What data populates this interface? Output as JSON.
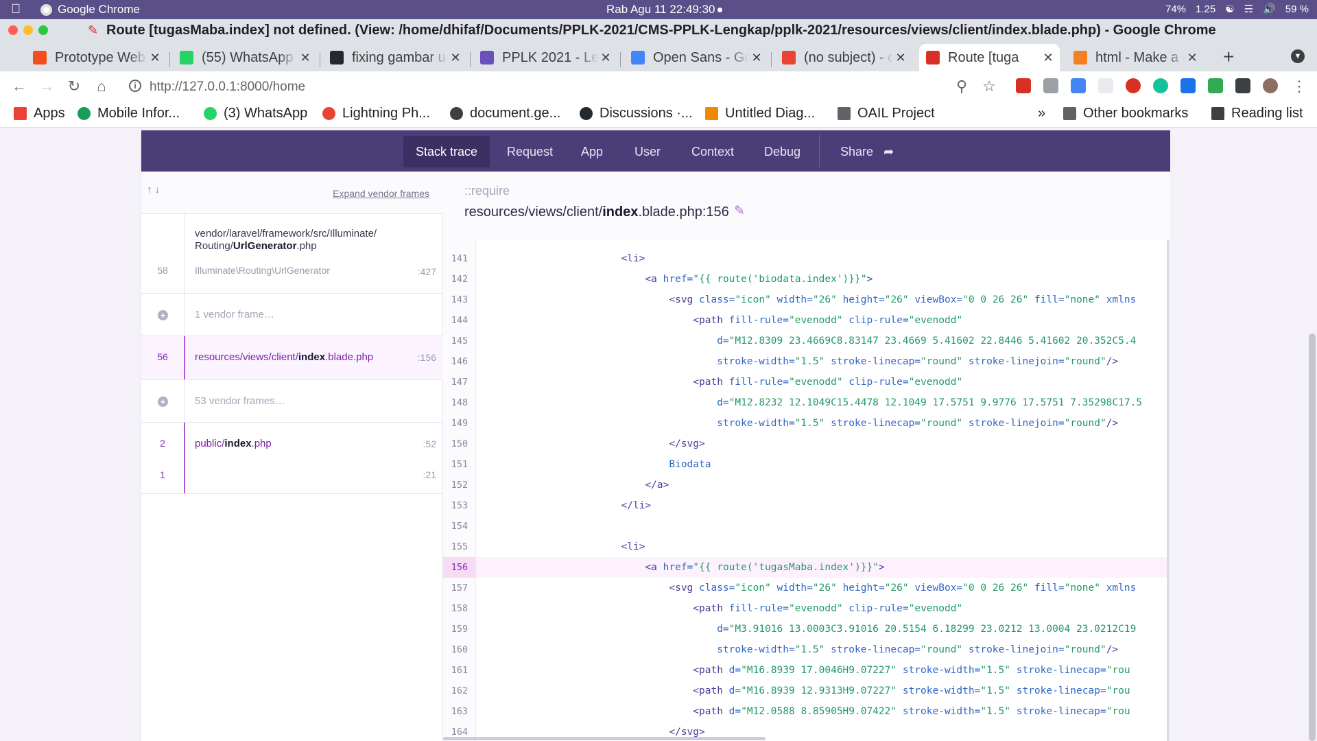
{
  "menubar": {
    "app_name": "Google Chrome",
    "clock": "Rab Agu 11  22:49:30",
    "status": [
      "74%",
      "1.25",
      "59 %"
    ]
  },
  "window": {
    "title": "Route [tugasMaba.index] not defined. (View: /home/dhifaf/Documents/PPLK-2021/CMS-PPLK-Lengkap/pplk-2021/resources/views/client/index.blade.php) - Google Chrome"
  },
  "tabs": [
    {
      "label": "Prototype Web",
      "icon": "figma-icon",
      "color": "#f24e1e"
    },
    {
      "label": "(55) WhatsApp",
      "icon": "whatsapp-icon",
      "color": "#25d366"
    },
    {
      "label": "fixing gambar u",
      "icon": "github-icon",
      "color": "#24292e"
    },
    {
      "label": "PPLK 2021 - Le",
      "icon": "pplk-icon",
      "color": "#6b4fbb"
    },
    {
      "label": "Open Sans - Go",
      "icon": "google-fonts-icon",
      "color": "#4285f4"
    },
    {
      "label": "(no subject) - d",
      "icon": "gmail-icon",
      "color": "#ea4335"
    },
    {
      "label": "Route [tuga",
      "icon": "laravel-icon",
      "color": "#d93025"
    },
    {
      "label": "html - Make a c",
      "icon": "stackoverflow-icon",
      "color": "#f48024"
    }
  ],
  "toolbar": {
    "url": "http://127.0.0.1:8000/home"
  },
  "bookmarks": [
    {
      "label": "Apps",
      "icon": "apps-grid-icon",
      "color": "#ea4335"
    },
    {
      "label": "Mobile Infor...",
      "icon": "mobile-info-icon",
      "color": "#1a9c5b"
    },
    {
      "label": "(3) WhatsApp",
      "icon": "whatsapp-icon",
      "color": "#25d366"
    },
    {
      "label": "Lightning Ph...",
      "icon": "google-icon",
      "color": "#ea4335"
    },
    {
      "label": "document.ge...",
      "icon": "globe-icon",
      "color": "#3c4043"
    },
    {
      "label": "Discussions ·...",
      "icon": "github-icon",
      "color": "#24292e"
    },
    {
      "label": "Untitled Diag...",
      "icon": "drawio-icon",
      "color": "#f08705"
    },
    {
      "label": "OAIL Project",
      "icon": "folder-icon",
      "color": "#5f6368"
    }
  ],
  "bookmarks_right": {
    "more": "»",
    "other": "Other bookmarks",
    "reading": "Reading list"
  },
  "ignition": {
    "tabs": [
      "Stack trace",
      "Request",
      "App",
      "User",
      "Context",
      "Debug"
    ],
    "share": "Share",
    "expand_vendor": "Expand vendor frames",
    "frames": [
      {
        "num": "58",
        "path_pre": "vendor/laravel/framework/src/Illuminate/",
        "path_mid": "Routing/",
        "path_bold": "UrlGenerator",
        "path_post": ".php",
        "class": "Illuminate\\Routing\\UrlGenerator",
        "line": ":427"
      },
      {
        "label": "1 vendor frame…"
      },
      {
        "num": "56",
        "path_pre": "resources/views/client/",
        "path_bold": "index",
        "path_post": ".blade.php",
        "line": ":156"
      },
      {
        "label": "53 vendor frames…"
      },
      {
        "num": "2",
        "path_pre": "public/",
        "path_bold": "index",
        "path_post": ".php",
        "line": ":52"
      },
      {
        "num": "1",
        "line": ":21"
      }
    ],
    "snippet": {
      "require": "::require",
      "file_pre": "resources/views/client/",
      "file_bold": "index",
      "file_post": ".blade.php:156"
    }
  },
  "code_lines": [
    {
      "n": "141",
      "indent": "                        ",
      "t": [
        [
          "tag",
          "<li>"
        ]
      ]
    },
    {
      "n": "142",
      "indent": "                            ",
      "t": [
        [
          "tag",
          "<a "
        ],
        [
          "attr",
          "href="
        ],
        [
          "str",
          "\"{{ route('biodata.index')}}\""
        ],
        [
          "tag",
          ">"
        ]
      ]
    },
    {
      "n": "143",
      "indent": "                                ",
      "t": [
        [
          "tag",
          "<svg "
        ],
        [
          "attr",
          "class="
        ],
        [
          "str",
          "\"icon\" "
        ],
        [
          "attr",
          "width="
        ],
        [
          "str",
          "\"26\" "
        ],
        [
          "attr",
          "height="
        ],
        [
          "str",
          "\"26\" "
        ],
        [
          "attr",
          "viewBox="
        ],
        [
          "str",
          "\"0 0 26 26\" "
        ],
        [
          "attr",
          "fill="
        ],
        [
          "str",
          "\"none\" "
        ],
        [
          "attr",
          "xmlns"
        ]
      ]
    },
    {
      "n": "144",
      "indent": "                                    ",
      "t": [
        [
          "tag",
          "<path "
        ],
        [
          "attr",
          "fill-rule="
        ],
        [
          "str",
          "\"evenodd\" "
        ],
        [
          "attr",
          "clip-rule="
        ],
        [
          "str",
          "\"evenodd\""
        ]
      ]
    },
    {
      "n": "145",
      "indent": "                                        ",
      "t": [
        [
          "attr",
          "d="
        ],
        [
          "str",
          "\"M12.8309 23.4669C8.83147 23.4669 5.41602 22.8446 5.41602 20.352C5.4"
        ]
      ]
    },
    {
      "n": "146",
      "indent": "                                        ",
      "t": [
        [
          "attr",
          "stroke-width="
        ],
        [
          "str",
          "\"1.5\" "
        ],
        [
          "attr",
          "stroke-linecap="
        ],
        [
          "str",
          "\"round\" "
        ],
        [
          "attr",
          "stroke-linejoin="
        ],
        [
          "str",
          "\"round\""
        ],
        [
          "tag",
          "/>"
        ]
      ]
    },
    {
      "n": "147",
      "indent": "                                    ",
      "t": [
        [
          "tag",
          "<path "
        ],
        [
          "attr",
          "fill-rule="
        ],
        [
          "str",
          "\"evenodd\" "
        ],
        [
          "attr",
          "clip-rule="
        ],
        [
          "str",
          "\"evenodd\""
        ]
      ]
    },
    {
      "n": "148",
      "indent": "                                        ",
      "t": [
        [
          "attr",
          "d="
        ],
        [
          "str",
          "\"M12.8232 12.1049C15.4478 12.1049 17.5751 9.9776 17.5751 7.35298C17.5"
        ]
      ]
    },
    {
      "n": "149",
      "indent": "                                        ",
      "t": [
        [
          "attr",
          "stroke-width="
        ],
        [
          "str",
          "\"1.5\" "
        ],
        [
          "attr",
          "stroke-linecap="
        ],
        [
          "str",
          "\"round\" "
        ],
        [
          "attr",
          "stroke-linejoin="
        ],
        [
          "str",
          "\"round\""
        ],
        [
          "tag",
          "/>"
        ]
      ]
    },
    {
      "n": "150",
      "indent": "                                ",
      "t": [
        [
          "tag",
          "</svg>"
        ]
      ]
    },
    {
      "n": "151",
      "indent": "                                ",
      "t": [
        [
          "txt",
          "Biodata"
        ]
      ]
    },
    {
      "n": "152",
      "indent": "                            ",
      "t": [
        [
          "tag",
          "</a>"
        ]
      ]
    },
    {
      "n": "153",
      "indent": "                        ",
      "t": [
        [
          "tag",
          "</li>"
        ]
      ]
    },
    {
      "n": "154",
      "indent": "",
      "t": []
    },
    {
      "n": "155",
      "indent": "                        ",
      "t": [
        [
          "tag",
          "<li>"
        ]
      ]
    },
    {
      "n": "156",
      "indent": "                            ",
      "hl": true,
      "t": [
        [
          "tag",
          "<a "
        ],
        [
          "attr",
          "href="
        ],
        [
          "str",
          "\"{{ route('tugasMaba.index')}}\""
        ],
        [
          "tag",
          ">"
        ]
      ]
    },
    {
      "n": "157",
      "indent": "                                ",
      "t": [
        [
          "tag",
          "<svg "
        ],
        [
          "attr",
          "class="
        ],
        [
          "str",
          "\"icon\" "
        ],
        [
          "attr",
          "width="
        ],
        [
          "str",
          "\"26\" "
        ],
        [
          "attr",
          "height="
        ],
        [
          "str",
          "\"26\" "
        ],
        [
          "attr",
          "viewBox="
        ],
        [
          "str",
          "\"0 0 26 26\" "
        ],
        [
          "attr",
          "fill="
        ],
        [
          "str",
          "\"none\" "
        ],
        [
          "attr",
          "xmlns"
        ]
      ]
    },
    {
      "n": "158",
      "indent": "                                    ",
      "t": [
        [
          "tag",
          "<path "
        ],
        [
          "attr",
          "fill-rule="
        ],
        [
          "str",
          "\"evenodd\" "
        ],
        [
          "attr",
          "clip-rule="
        ],
        [
          "str",
          "\"evenodd\""
        ]
      ]
    },
    {
      "n": "159",
      "indent": "                                        ",
      "t": [
        [
          "attr",
          "d="
        ],
        [
          "str",
          "\"M3.91016 13.0003C3.91016 20.5154 6.18299 23.0212 13.0004 23.0212C19"
        ]
      ]
    },
    {
      "n": "160",
      "indent": "                                        ",
      "t": [
        [
          "attr",
          "stroke-width="
        ],
        [
          "str",
          "\"1.5\" "
        ],
        [
          "attr",
          "stroke-linecap="
        ],
        [
          "str",
          "\"round\" "
        ],
        [
          "attr",
          "stroke-linejoin="
        ],
        [
          "str",
          "\"round\""
        ],
        [
          "tag",
          "/>"
        ]
      ]
    },
    {
      "n": "161",
      "indent": "                                    ",
      "t": [
        [
          "tag",
          "<path "
        ],
        [
          "attr",
          "d="
        ],
        [
          "str",
          "\"M16.8939 17.0046H9.07227\" "
        ],
        [
          "attr",
          "stroke-width="
        ],
        [
          "str",
          "\"1.5\" "
        ],
        [
          "attr",
          "stroke-linecap="
        ],
        [
          "str",
          "\"rou"
        ]
      ]
    },
    {
      "n": "162",
      "indent": "                                    ",
      "t": [
        [
          "tag",
          "<path "
        ],
        [
          "attr",
          "d="
        ],
        [
          "str",
          "\"M16.8939 12.9313H9.07227\" "
        ],
        [
          "attr",
          "stroke-width="
        ],
        [
          "str",
          "\"1.5\" "
        ],
        [
          "attr",
          "stroke-linecap="
        ],
        [
          "str",
          "\"rou"
        ]
      ]
    },
    {
      "n": "163",
      "indent": "                                    ",
      "t": [
        [
          "tag",
          "<path "
        ],
        [
          "attr",
          "d="
        ],
        [
          "str",
          "\"M12.0588 8.85905H9.07422\" "
        ],
        [
          "attr",
          "stroke-width="
        ],
        [
          "str",
          "\"1.5\" "
        ],
        [
          "attr",
          "stroke-linecap="
        ],
        [
          "str",
          "\"rou"
        ]
      ]
    },
    {
      "n": "164",
      "indent": "                                ",
      "t": [
        [
          "tag",
          "</svg>"
        ]
      ]
    }
  ]
}
